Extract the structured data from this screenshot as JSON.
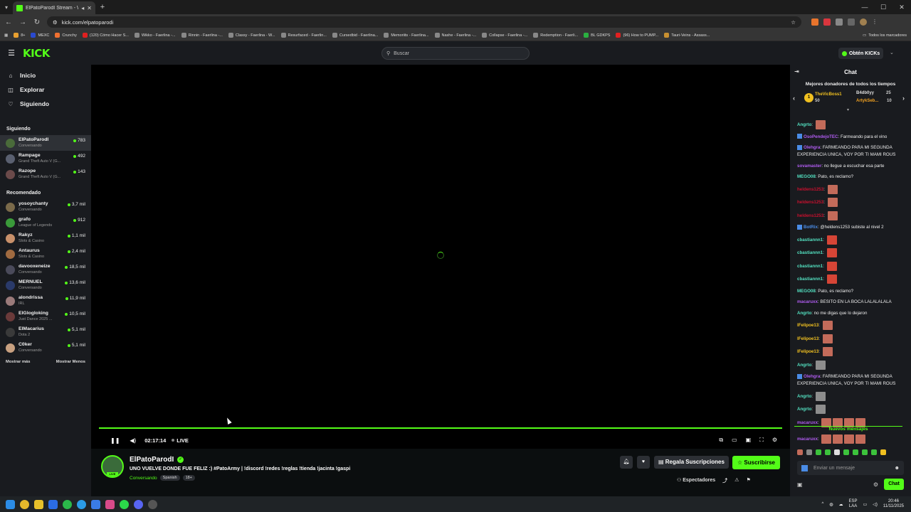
{
  "browser": {
    "tab_title": "ElPatoParodI Stream - Wat",
    "url": "kick.com/elpatoparodi",
    "bookmarks": [
      "8+",
      "MEXC",
      "Crunchy",
      "(120) Cómo Hacer S...",
      "Wikko - Faerlina -...",
      "Rinnin - Faerlina -...",
      "Classy - Faerlina - W...",
      "Resurfaced - Faerlin...",
      "Cursedbid - Faerlina...",
      "Memoriits - Faerlina...",
      "Nashe - Faerlina -...",
      "Collapse - Faerlina -...",
      "Redemption - Faerli...",
      "BL GDKPS",
      "(96) How to PUMP...",
      "Tauri-Veins - Assass..."
    ],
    "all_bookmarks": "Todos los marcadores"
  },
  "header": {
    "logo": "KICK",
    "search_placeholder": "Buscar",
    "kicks_label": "Obtén KICKs"
  },
  "sidebar": {
    "nav": [
      {
        "label": "Inicio",
        "icon": "home-icon"
      },
      {
        "label": "Explorar",
        "icon": "compass-icon"
      },
      {
        "label": "Siguiendo",
        "icon": "heart-icon"
      }
    ],
    "following_title": "Siguiendo",
    "following": [
      {
        "name": "ElPatoParodI",
        "category": "Conversando",
        "viewers": "783",
        "color": "#4a6b3a"
      },
      {
        "name": "Rampage",
        "category": "Grand Theft Auto V (G...",
        "viewers": "492",
        "color": "#5a6070"
      },
      {
        "name": "Razope",
        "category": "Grand Theft Auto V (G...",
        "viewers": "143",
        "color": "#6b4a4a"
      }
    ],
    "recommended_title": "Recomendado",
    "recommended": [
      {
        "name": "yosoychanty",
        "category": "Conversando",
        "viewers": "3,7 mil",
        "color": "#7a6a4a"
      },
      {
        "name": "grafo",
        "category": "League of Legends",
        "viewers": "912",
        "color": "#3a9a3a"
      },
      {
        "name": "Rakyz",
        "category": "Slots & Casino",
        "viewers": "1,1 mil",
        "color": "#c8906a"
      },
      {
        "name": "Antaurus",
        "category": "Slots & Casino",
        "viewers": "2,4 mil",
        "color": "#a06a40"
      },
      {
        "name": "davooxeneize",
        "category": "Conversando",
        "viewers": "18,5 mil",
        "color": "#4a4a5a"
      },
      {
        "name": "MERNUEL",
        "category": "Conversando",
        "viewers": "13,6 mil",
        "color": "#2a3a6a"
      },
      {
        "name": "alondrissa",
        "category": "IRL",
        "viewers": "11,9 mil",
        "color": "#9a7a7a"
      },
      {
        "name": "ElGlogloking",
        "category": "Just Dance 2025 ...",
        "viewers": "10,5 mil",
        "color": "#6a3a3a"
      },
      {
        "name": "ElMacarius",
        "category": "Dota 2",
        "viewers": "5,1 mil",
        "color": "#3a3a3a"
      },
      {
        "name": "C0ker",
        "category": "Conversando",
        "viewers": "5,1 mil",
        "color": "#c8a080"
      }
    ],
    "show_more": "Mostrar más",
    "show_less": "Mostrar Menos"
  },
  "player": {
    "time": "02:17:14",
    "live": "LIVE",
    "progress": 1.0
  },
  "stream": {
    "name": "ElPatoParodI",
    "title": "UNO VUELVE DONDE FUE FELIZ :) #PatoArmy | !discord !redes !reglas !tienda !jacinta !gaspi",
    "category": "Conversando",
    "tags": [
      "Spanish",
      "18+"
    ],
    "gift_label": "Regala Suscripciones",
    "subscribe_label": "Suscribirse",
    "viewers_label": "Espectadores",
    "live_badge": "LIVE"
  },
  "chat": {
    "title": "Chat",
    "donors_title": "Mejores donadores de todos los tiempos",
    "donors": [
      {
        "rank": "1",
        "name": "TheVicBoss1",
        "amount": "50"
      },
      {
        "name": "B4db0yy",
        "amount": "25"
      },
      {
        "name": "ArtykSeb...",
        "amount": "10"
      }
    ],
    "messages": [
      {
        "user": "Angrto",
        "color": "#53e0c0",
        "text": "",
        "emotes": 1
      },
      {
        "user": "OsoPendejoTEC",
        "color": "#b05cf0",
        "text": "Farmeando para el vino",
        "emotes": 0,
        "badge": true
      },
      {
        "user": "Olehgra",
        "color": "#b05cf0",
        "text": "FARMEANDO PARA MI SEGUNDA EXPERIENCIA UNICA, VOY POR TI MAMI ROUS",
        "emotes": 0,
        "badge": true
      },
      {
        "user": "sovamaster",
        "color": "#b05cf0",
        "text": "no llegue a escuchar esa parte",
        "emotes": 0
      },
      {
        "user": "MEGO08",
        "color": "#53e0c0",
        "text": "Pato, es reclamo?",
        "emotes": 0
      },
      {
        "user": "heldens1253",
        "color": "#c8102e",
        "text": "",
        "emotes": 1
      },
      {
        "user": "heldens1253",
        "color": "#c8102e",
        "text": "",
        "emotes": 1
      },
      {
        "user": "heldens1253",
        "color": "#c8102e",
        "text": "",
        "emotes": 1
      },
      {
        "user": "BotRix",
        "color": "#4a8ce6",
        "text": "@heldens1253 subiste al nivel 2",
        "emotes": 0,
        "badge": true
      },
      {
        "user": "cbastiannn1",
        "color": "#53e0c0",
        "text": "",
        "emotes": 1,
        "red": true
      },
      {
        "user": "cbastiannn1",
        "color": "#53e0c0",
        "text": "",
        "emotes": 1,
        "red": true
      },
      {
        "user": "cbastiannn1",
        "color": "#53e0c0",
        "text": "",
        "emotes": 1,
        "red": true
      },
      {
        "user": "cbastiannn1",
        "color": "#53e0c0",
        "text": "",
        "emotes": 1,
        "red": true
      },
      {
        "user": "MEGO08",
        "color": "#53e0c0",
        "text": "Pato, es reclamo?",
        "emotes": 0
      },
      {
        "user": "macaruxx",
        "color": "#b05cf0",
        "text": "BESITO EN LA BOCA LALALALALA",
        "emotes": 0
      },
      {
        "user": "Angrto",
        "color": "#53e0c0",
        "text": "no me digas que lo dejaron",
        "emotes": 0
      },
      {
        "user": "lFelipoe13",
        "color": "#f0c020",
        "text": "",
        "emotes": 1
      },
      {
        "user": "lFelipoe13",
        "color": "#f0c020",
        "text": "",
        "emotes": 1
      },
      {
        "user": "lFelipoe13",
        "color": "#f0c020",
        "text": "",
        "emotes": 1
      },
      {
        "user": "Angrto",
        "color": "#53e0c0",
        "text": "",
        "emotes": 1,
        "grey": true
      },
      {
        "user": "Olehgra",
        "color": "#b05cf0",
        "text": "FARMEANDO PARA MI SEGUNDA EXPERIENCIA UNICA, VOY POR TI MAMI ROUS",
        "emotes": 0,
        "badge": true
      },
      {
        "user": "Angrto",
        "color": "#53e0c0",
        "text": "",
        "emotes": 1,
        "grey": true
      },
      {
        "user": "Angrto",
        "color": "#53e0c0",
        "text": "",
        "emotes": 1,
        "grey": true
      },
      {
        "user": "macaruxx",
        "color": "#b05cf0",
        "text": "",
        "emotes": 4
      }
    ],
    "new_messages": "Nuevos mensajes",
    "last_message": {
      "user": "macaruxx",
      "color": "#b05cf0",
      "emotes": 4
    },
    "input_placeholder": "Enviar un mensaje",
    "send_label": "Chat"
  },
  "taskbar": {
    "lang_top": "ESP",
    "lang_bottom": "LAA",
    "time": "20:46",
    "date": "11/11/2025"
  }
}
